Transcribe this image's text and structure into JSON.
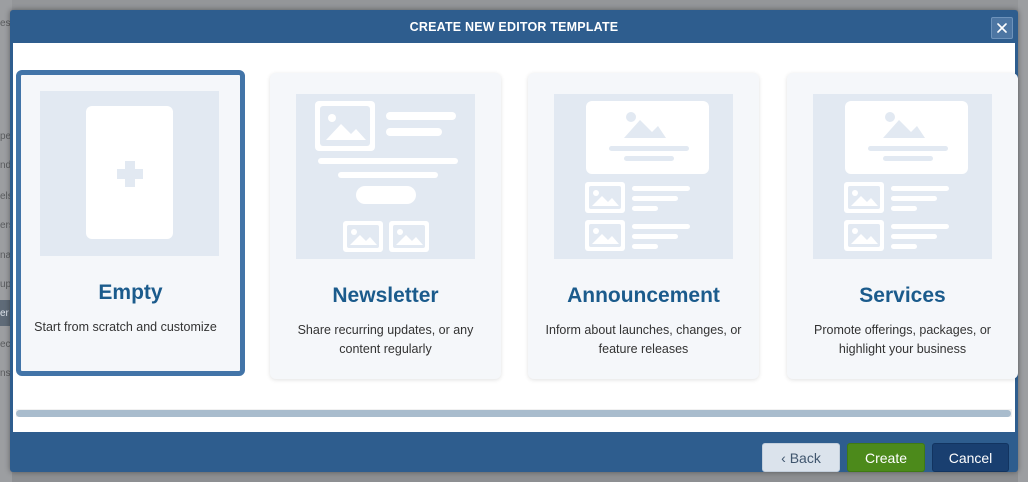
{
  "background": {
    "left_fragments": [
      "es",
      "pec",
      "nd",
      "els",
      "ers",
      "na",
      "up",
      "er",
      "ect",
      "ns f"
    ]
  },
  "dialog": {
    "title": "CREATE NEW EDITOR TEMPLATE",
    "close_icon": "close-icon"
  },
  "templates": [
    {
      "title": "Empty",
      "description": "Start from scratch and customize",
      "selected": true,
      "icon": "blank-page-plus-icon"
    },
    {
      "title": "Newsletter",
      "description": "Share recurring updates, or any content regularly",
      "selected": false,
      "icon": "newsletter-layout-icon"
    },
    {
      "title": "Announcement",
      "description": "Inform about launches, changes, or feature releases",
      "selected": false,
      "icon": "announcement-layout-icon"
    },
    {
      "title": "Services",
      "description": "Promote offerings, packages, or highlight your business",
      "selected": false,
      "icon": "services-layout-icon"
    }
  ],
  "footer": {
    "back_label": "‹ Back",
    "create_label": "Create",
    "cancel_label": "Cancel"
  },
  "colors": {
    "dialog_blue": "#2e5d8e",
    "selected_border": "#4274a8",
    "title_blue": "#1b5b8c",
    "create_green": "#4c8a1b",
    "cancel_navy": "#193f70",
    "thumb_bg": "#e2e9f2"
  }
}
